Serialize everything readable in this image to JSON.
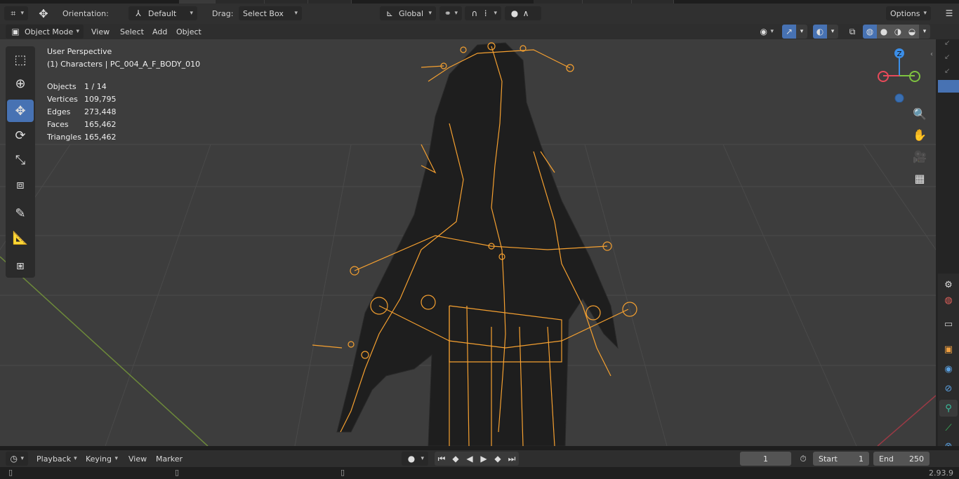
{
  "header": {
    "orientation_label": "Orientation:",
    "orientation_value": "Default",
    "drag_label": "Drag:",
    "drag_value": "Select Box",
    "transform_space": "Global",
    "options_label": "Options"
  },
  "menu": {
    "mode": "Object Mode",
    "items": [
      "View",
      "Select",
      "Add",
      "Object"
    ]
  },
  "viewport_info": {
    "view_name": "User Perspective",
    "context": "(1) Characters | PC_004_A_F_BODY_010",
    "stats": [
      {
        "label": "Objects",
        "value": "1 / 14"
      },
      {
        "label": "Vertices",
        "value": "109,795"
      },
      {
        "label": "Edges",
        "value": "273,448"
      },
      {
        "label": "Faces",
        "value": "165,462"
      },
      {
        "label": "Triangles",
        "value": "165,462"
      }
    ]
  },
  "gizmo": {
    "z_label": "Z"
  },
  "timeline": {
    "items": [
      "Playback",
      "Keying",
      "View",
      "Marker"
    ],
    "current_frame": "1",
    "start_label": "Start",
    "start_value": "1",
    "end_label": "End",
    "end_value": "250"
  },
  "status": {
    "version": "2.93.9"
  },
  "colors": {
    "accent": "#4772b3",
    "bone": "#f5a030",
    "x_axis": "#e84a5a",
    "y_axis": "#7ec240",
    "z_axis": "#3b8ee8"
  }
}
